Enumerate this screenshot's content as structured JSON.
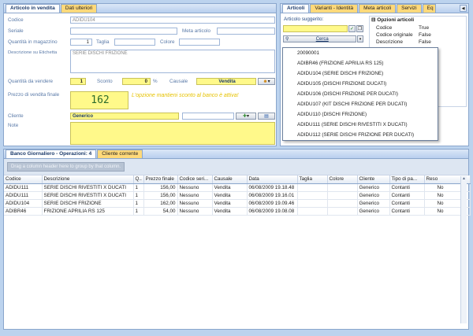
{
  "left_tabs": [
    "Articolo in vendita",
    "Dati ulteriori"
  ],
  "form": {
    "codice_label": "Codice",
    "codice_value": "ADIDU104",
    "seriale_label": "Seriale",
    "meta_label": "Meta articolo",
    "qty_mag_label": "Quantità in magazzino",
    "qty_mag_value": "1",
    "taglia_label": "Taglia",
    "colore_label": "Colore",
    "descr_label": "Descrizione su Etichetta",
    "descr_value": "SERIE DISCHI FRIZIONE",
    "qty_vend_label": "Quantità da vendere",
    "qty_vend_value": "1",
    "sconto_label": "Sconto",
    "sconto_value": "0",
    "percent": "%",
    "causale_label": "Causale",
    "causale_value": "Vendita",
    "prezzo_label": "Prezzo di vendita finale",
    "prezzo_value": "162",
    "prezzo_hint": "L'opzione mantieni sconto al banco è attiva!",
    "cliente_label": "Cliente",
    "cliente_value": "Generico",
    "note_label": "Note"
  },
  "right_tabs": [
    "Articoli",
    "Varianti - Identità",
    "Meta articoli",
    "Servizi",
    "Eq"
  ],
  "suggest": {
    "label": "Articolo suggerito:",
    "cerca": "Cerca",
    "items": [
      "20090001",
      "ADIBR46 (FRIZIONE APRILIA RS 125)",
      "ADIDU104 (SERIE DISCHI FRIZIONE)",
      "ADIDU105 (DISCHI FRIZIONE DUCATI)",
      "ADIDU106 (DISCHI FRIZIONE PER DUCATI)",
      "ADIDU107 (KIT DISCHI FRIZIONE PER DUCATI)",
      "ADIDU110 (DISCHI FRIZIONE)",
      "ADIDU111 (SERIE DISCHI RIVESTITI X DUCATI)",
      "ADIDU112 (SERIE DISCHI FRIZIONE PER DUCATI)"
    ]
  },
  "options": {
    "header": "Opzioni articoli",
    "rows": [
      [
        "Codice",
        "True"
      ],
      [
        "Codice originale",
        "False"
      ],
      [
        "Descrizione",
        "False"
      ]
    ]
  },
  "bottom_tabs": [
    "Banco Giornaliero - Operazioni: 4",
    "Cliente corrente"
  ],
  "grid": {
    "group_hint": "Drag a column header here to group by that column.",
    "columns": [
      "Codice",
      "Descrizione",
      "Q..",
      "Prezzo finale",
      "Codice seri...",
      "Causale",
      "Data",
      "Taglia",
      "Colore",
      "Cliente",
      "Tipo di pa...",
      "Reso"
    ],
    "rows": [
      [
        "ADIDU111",
        "SERIE DISCHI RIVESTITI X DUCATI",
        "1",
        "156,00",
        "Nessuno",
        "Vendita",
        "06/08/2009 19.18.48",
        "",
        "",
        "Generico",
        "Contanti",
        "No"
      ],
      [
        "ADIDU111",
        "SERIE DISCHI RIVESTITI X DUCATI",
        "1",
        "156,00",
        "Nessuno",
        "Vendita",
        "06/08/2009 19.16.01",
        "",
        "",
        "Generico",
        "Contanti",
        "No"
      ],
      [
        "ADIDU104",
        "SERIE  DISCHI FRIZIONE",
        "1",
        "162,00",
        "Nessuno",
        "Vendita",
        "06/08/2009 19.09.46",
        "",
        "",
        "Generico",
        "Contanti",
        "No"
      ],
      [
        "ADIBR46",
        "FRIZIONE APRILIA RS 125",
        "1",
        "54,00",
        "Nessuno",
        "Vendita",
        "06/08/2009 19.08.08",
        "",
        "",
        "Generico",
        "Contanti",
        "No"
      ]
    ]
  },
  "colors": {
    "accent_yellow": "#fff98a",
    "hint_yellow": "#ffd400",
    "frame_blue": "#bcd3ee"
  },
  "icons": [
    "search-icon",
    "copy-icon",
    "person-icon",
    "add-customer-icon",
    "customer-search-icon",
    "scroll-left-icon",
    "scroll-right-icon"
  ]
}
